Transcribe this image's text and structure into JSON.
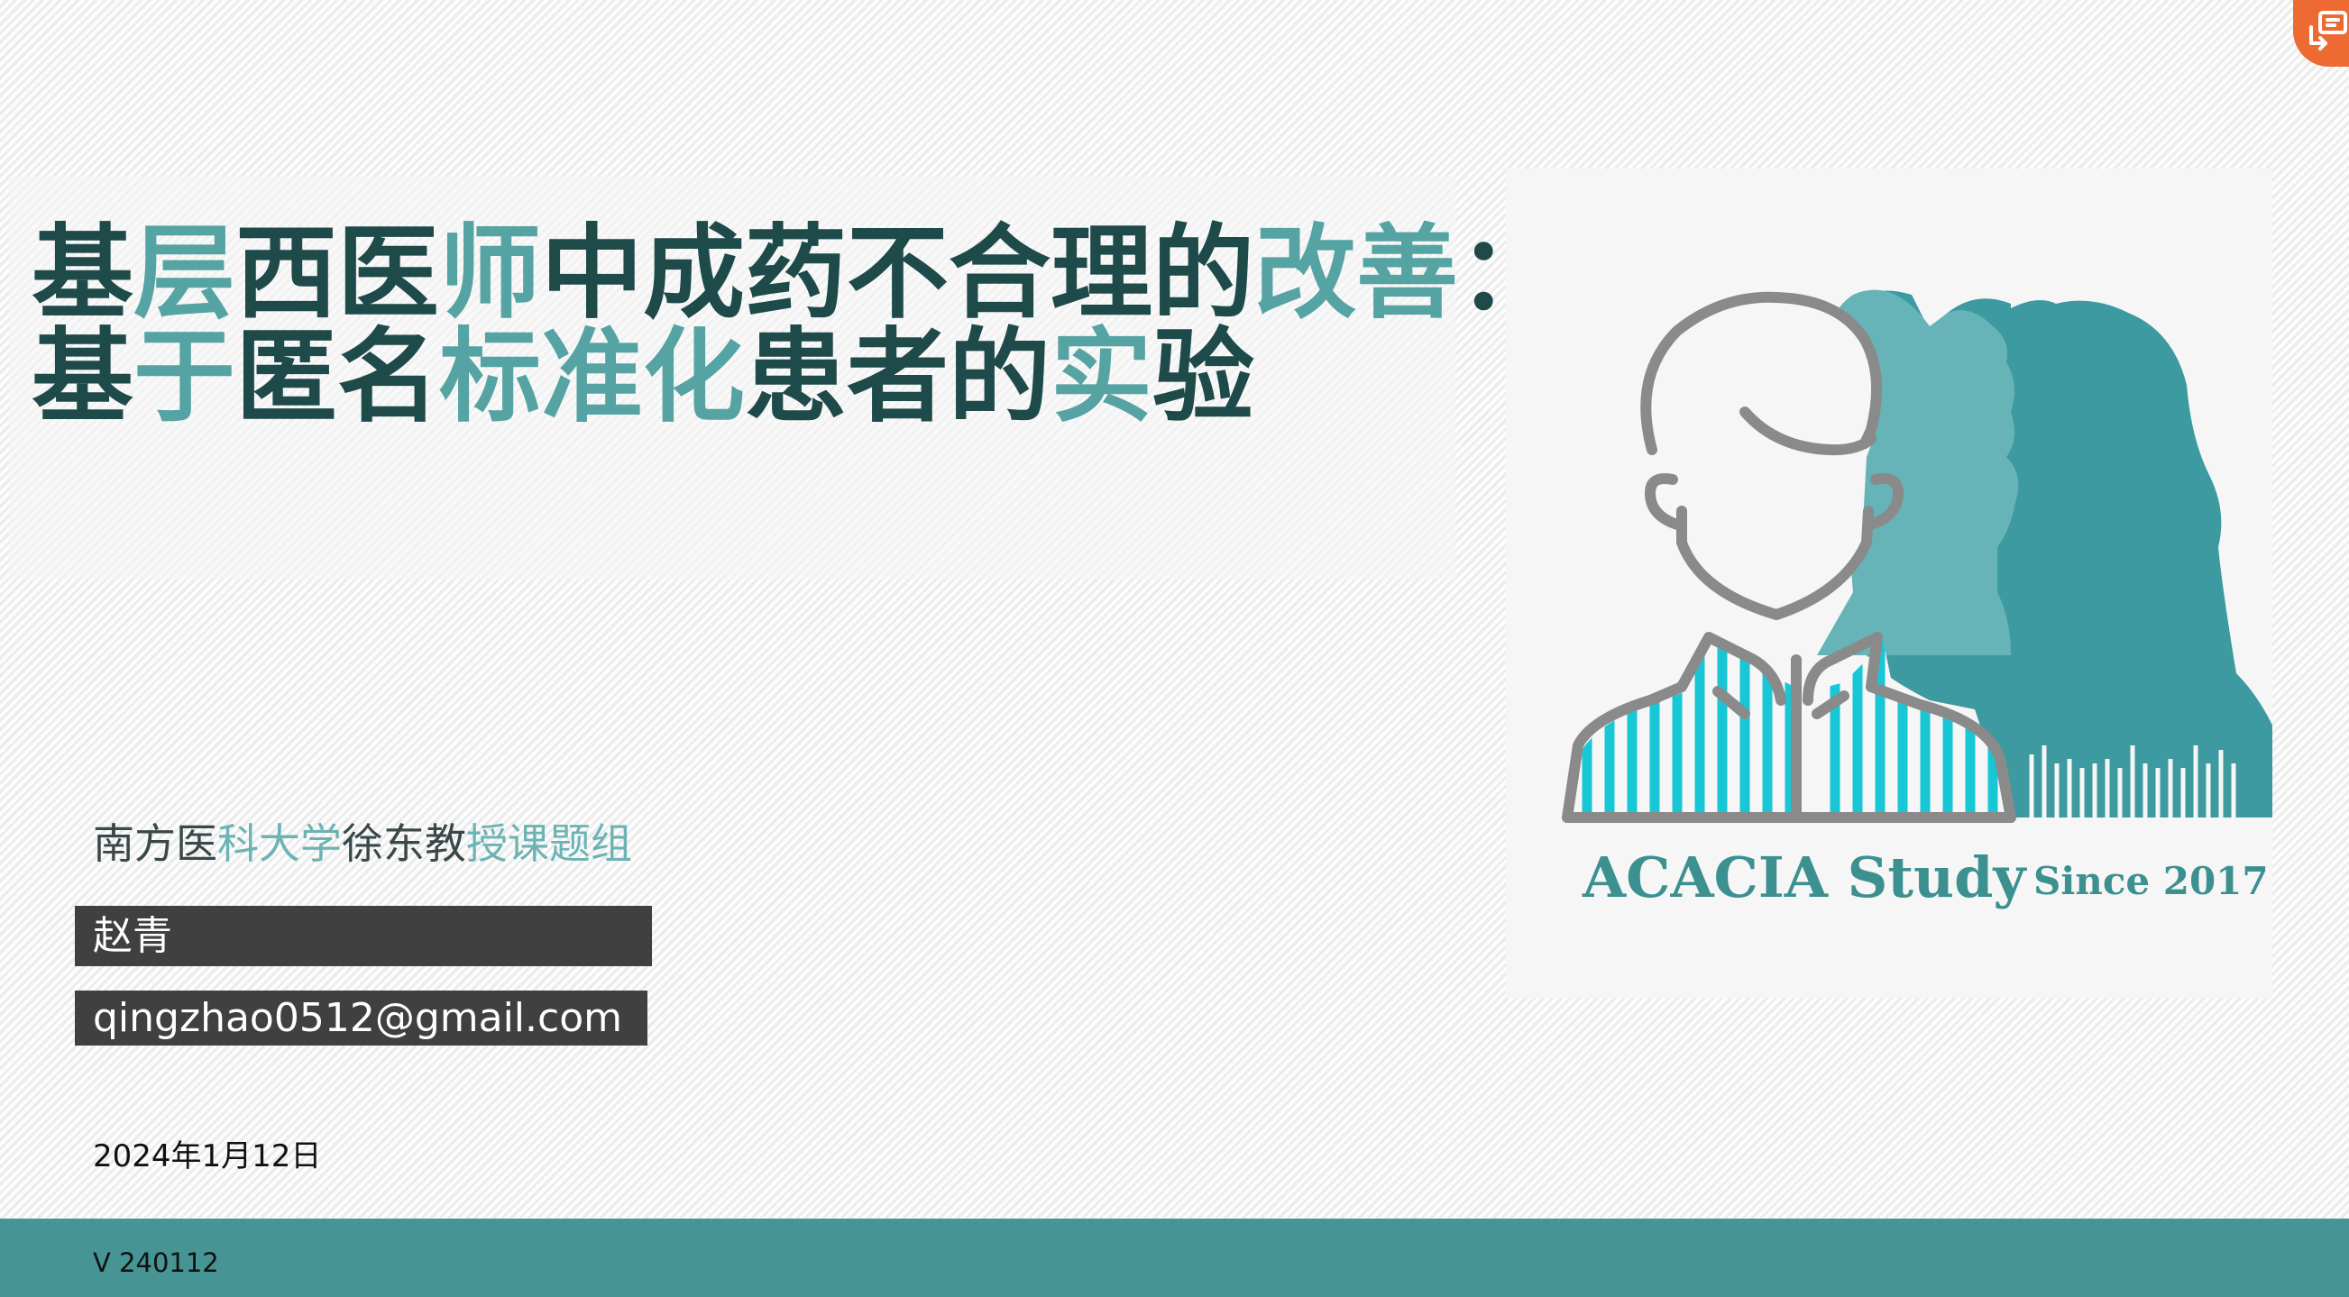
{
  "slide": {
    "title_line1_segments": [
      {
        "text": "基",
        "tone": "dark"
      },
      {
        "text": "层",
        "tone": "teal"
      },
      {
        "text": "西医",
        "tone": "dark"
      },
      {
        "text": "师",
        "tone": "teal"
      },
      {
        "text": "中成药不合理的",
        "tone": "dark"
      },
      {
        "text": "改善",
        "tone": "teal"
      },
      {
        "text": "：",
        "tone": "dark"
      }
    ],
    "title_line2_segments": [
      {
        "text": "基",
        "tone": "dark"
      },
      {
        "text": "于",
        "tone": "teal"
      },
      {
        "text": "匿",
        "tone": "dark"
      },
      {
        "text": "名",
        "tone": "dark"
      },
      {
        "text": "标准化",
        "tone": "teal"
      },
      {
        "text": "患者",
        "tone": "dark"
      },
      {
        "text": "的",
        "tone": "dark"
      },
      {
        "text": "实",
        "tone": "teal"
      },
      {
        "text": "验",
        "tone": "dark"
      }
    ],
    "org_segments": [
      {
        "text": "南方医",
        "tone": "dark"
      },
      {
        "text": "科大学",
        "tone": "teal"
      },
      {
        "text": "徐东教",
        "tone": "dark"
      },
      {
        "text": "授课题组",
        "tone": "teal"
      }
    ],
    "author_name": "赵青",
    "email": "qingzhao0512@gmail.com",
    "date": "2024年1月12日",
    "version": "V 240112",
    "logo": {
      "study_name": "ACACIA Study",
      "since": "Since 2017"
    }
  },
  "colors": {
    "title_dark": "#1e4a4a",
    "title_teal": "#55a3a3",
    "footer_bar": "#479494",
    "name_box": "#404040",
    "logo_text": "#3c9090",
    "stripe": "#17c7d6",
    "corner_button": "#ee6a33"
  },
  "icons": {
    "corner_button": "presentation-toggle-icon",
    "logo": "patient-silhouette-logo"
  }
}
